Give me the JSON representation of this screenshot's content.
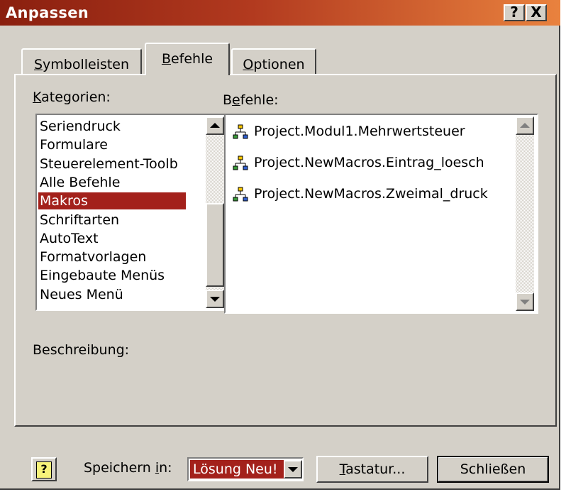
{
  "window": {
    "title": "Anpassen",
    "help_button": "?",
    "close_button": "X"
  },
  "tabs": [
    {
      "label": "Symbolleisten",
      "accesskey": "S"
    },
    {
      "label": "Befehle",
      "accesskey": "B"
    },
    {
      "label": "Optionen",
      "accesskey": "O"
    }
  ],
  "categories": {
    "label": "Kategorien:",
    "items": [
      "Seriendruck",
      "Formulare",
      "Steuerelement-Toolb",
      "Alle Befehle",
      "Makros",
      "Schriftarten",
      "AutoText",
      "Formatvorlagen",
      "Eingebaute Menüs",
      "Neues Menü"
    ],
    "selected": "Makros"
  },
  "commands": {
    "label": "Befehle:",
    "items": [
      "Project.Modul1.Mehrwertsteuer",
      "Project.NewMacros.Eintrag_loesch",
      "Project.NewMacros.Zweimal_druck"
    ],
    "item_icon": "macro-icon"
  },
  "description": {
    "label": "Beschreibung:"
  },
  "footer": {
    "help_icon": "?",
    "save_in_label": "Speichern in:",
    "save_in_value": "Lösung Neu!",
    "keyboard_button": "Tastatur...",
    "close_button": "Schließen"
  },
  "colors": {
    "title_start": "#8a1f0f",
    "title_end": "#e9823e",
    "selection": "#a3211b",
    "face": "#d4d0c8"
  }
}
